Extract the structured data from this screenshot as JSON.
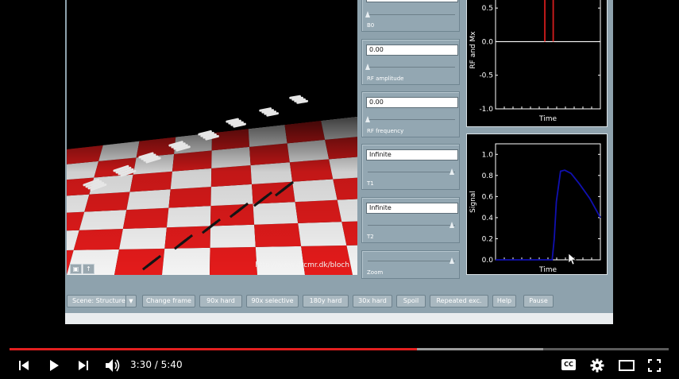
{
  "scene": {
    "url_label": "http://www.drcmr.dk/bloch",
    "icons": [
      "lock-icon",
      "arrow-up-icon"
    ]
  },
  "panels": [
    {
      "id": "b0",
      "value": "",
      "label": "B0",
      "slider": 0.0
    },
    {
      "id": "rf_amplitude",
      "value": "0.00",
      "label": "RF amplitude",
      "slider": 0.0
    },
    {
      "id": "rf_frequency",
      "value": "0.00",
      "label": "RF frequency",
      "slider": 0.0
    },
    {
      "id": "t1",
      "value": "Infinite",
      "label": "T1",
      "slider": 1.0
    },
    {
      "id": "t2",
      "value": "Infinite",
      "label": "T2",
      "slider": 1.0
    },
    {
      "id": "zoom",
      "value": "",
      "label": "Zoom",
      "slider": 1.0
    }
  ],
  "chart_data": [
    {
      "type": "line",
      "title": "",
      "xlabel": "Time",
      "ylabel": "RF and Mx",
      "yticks": [
        "0.5",
        "0.0",
        "-0.5",
        "-1.0"
      ],
      "ylim": [
        -1.0,
        0.75
      ],
      "series": [
        {
          "color": "#ffffff",
          "x": [
            0,
            1
          ],
          "y": [
            0,
            0
          ]
        },
        {
          "color": "#d21d1d",
          "x": [
            0.47,
            0.47
          ],
          "y": [
            0,
            0.75
          ]
        },
        {
          "color": "#d21d1d",
          "x": [
            0.55,
            0.55
          ],
          "y": [
            0,
            0.75
          ]
        }
      ]
    },
    {
      "type": "line",
      "title": "",
      "xlabel": "Time",
      "ylabel": "Signal",
      "yticks": [
        "1.0",
        "0.8",
        "0.6",
        "0.4",
        "0.2",
        "0.0"
      ],
      "ylim": [
        0,
        1.1
      ],
      "series": [
        {
          "color": "#1010b0",
          "x": [
            0,
            0.54,
            0.56,
            0.58,
            0.62,
            0.66,
            0.72,
            0.8,
            0.9,
            1.0
          ],
          "y": [
            0,
            0,
            0.2,
            0.55,
            0.84,
            0.85,
            0.82,
            0.72,
            0.58,
            0.4
          ]
        }
      ]
    }
  ],
  "toolbar": {
    "scene_select": "Scene: Structure",
    "buttons": [
      "Change frame",
      "90x hard",
      "90x selective",
      "180y hard",
      "30x hard",
      "Spoil",
      "Repeated exc.",
      "Help",
      "Pause"
    ]
  },
  "player": {
    "current_time": "3:30",
    "separator": " / ",
    "duration": "5:40",
    "progress": 0.618,
    "buffered": 0.81,
    "icons": [
      "previous-icon",
      "play-icon",
      "next-icon",
      "volume-icon",
      "captions-icon",
      "settings-icon",
      "theater-mode-icon",
      "fullscreen-icon"
    ],
    "captions_label": "CC"
  },
  "colors": {
    "accent": "#e21f1f",
    "checker_red": "#e41b1b",
    "checker_white": "#f4f4f4"
  }
}
